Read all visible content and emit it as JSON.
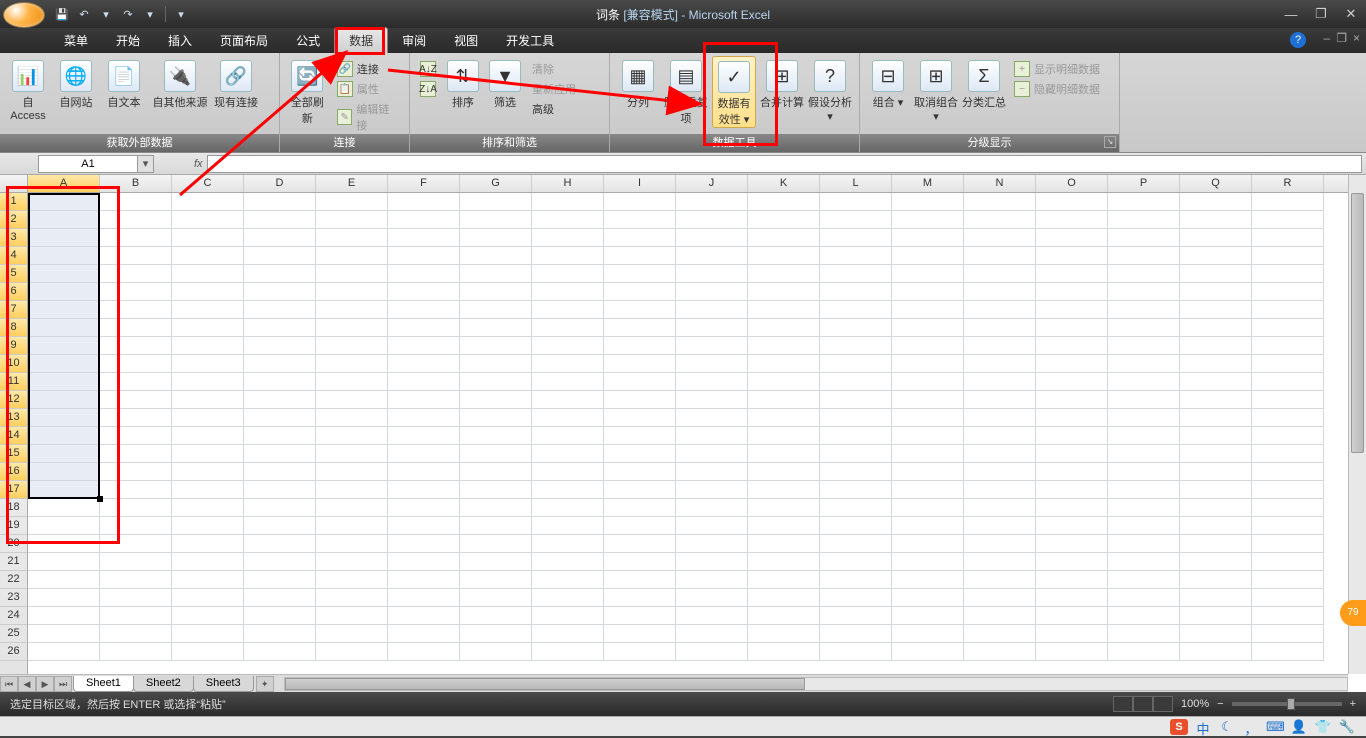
{
  "title": {
    "doc": "词条",
    "mode": "[兼容模式]",
    "app": "Microsoft Excel"
  },
  "qat": {
    "save": "💾",
    "undo": "↶",
    "redo": "↷",
    "drop": "▾"
  },
  "win": {
    "min": "—",
    "max": "❐",
    "close": "✕"
  },
  "tabs": [
    "菜单",
    "开始",
    "插入",
    "页面布局",
    "公式",
    "数据",
    "审阅",
    "视图",
    "开发工具"
  ],
  "active_tab": 5,
  "mdi": {
    "min": "–",
    "restore": "❐",
    "close": "×"
  },
  "ribbon": {
    "g1": {
      "title": "获取外部数据",
      "btns": [
        "自 Access",
        "自网站",
        "自文本",
        "自其他来源",
        "现有连接"
      ]
    },
    "g2": {
      "title": "连接",
      "main": "全部刷新",
      "items": [
        "连接",
        "属性",
        "编辑链接"
      ]
    },
    "g3": {
      "title": "排序和筛选",
      "sortaz": "A↓Z",
      "sortza": "Z↓A",
      "sort": "排序",
      "filter": "筛选",
      "clear": "清除",
      "reapply": "重新应用",
      "adv": "高级"
    },
    "g4": {
      "title": "数据工具",
      "btns": [
        "分列",
        "删除重复项",
        "数据有效性",
        "合并计算",
        "假设分析"
      ]
    },
    "g5": {
      "title": "分级显示",
      "btns": [
        "组合",
        "取消组合",
        "分类汇总"
      ],
      "show": "显示明细数据",
      "hide": "隐藏明细数据"
    }
  },
  "namebox": "A1",
  "fx": "fx",
  "cols": [
    "A",
    "B",
    "C",
    "D",
    "E",
    "F",
    "G",
    "H",
    "I",
    "J",
    "K",
    "L",
    "M",
    "N",
    "O",
    "P",
    "Q",
    "R"
  ],
  "rows_visible": 26,
  "selected_rows": 17,
  "sheets": [
    "Sheet1",
    "Sheet2",
    "Sheet3"
  ],
  "sheetnav": [
    "⏮",
    "◀",
    "▶",
    "⏭"
  ],
  "status": "选定目标区域，然后按 ENTER 或选择“粘贴”",
  "zoom": "100%",
  "badge": "79",
  "tb_icons": {
    "sogou": "S",
    "zhong": "中",
    "moon": "☾",
    "comma": "，",
    "kbd": "⌨",
    "person": "👤",
    "shirt": "👕",
    "wrench": "🔧"
  }
}
